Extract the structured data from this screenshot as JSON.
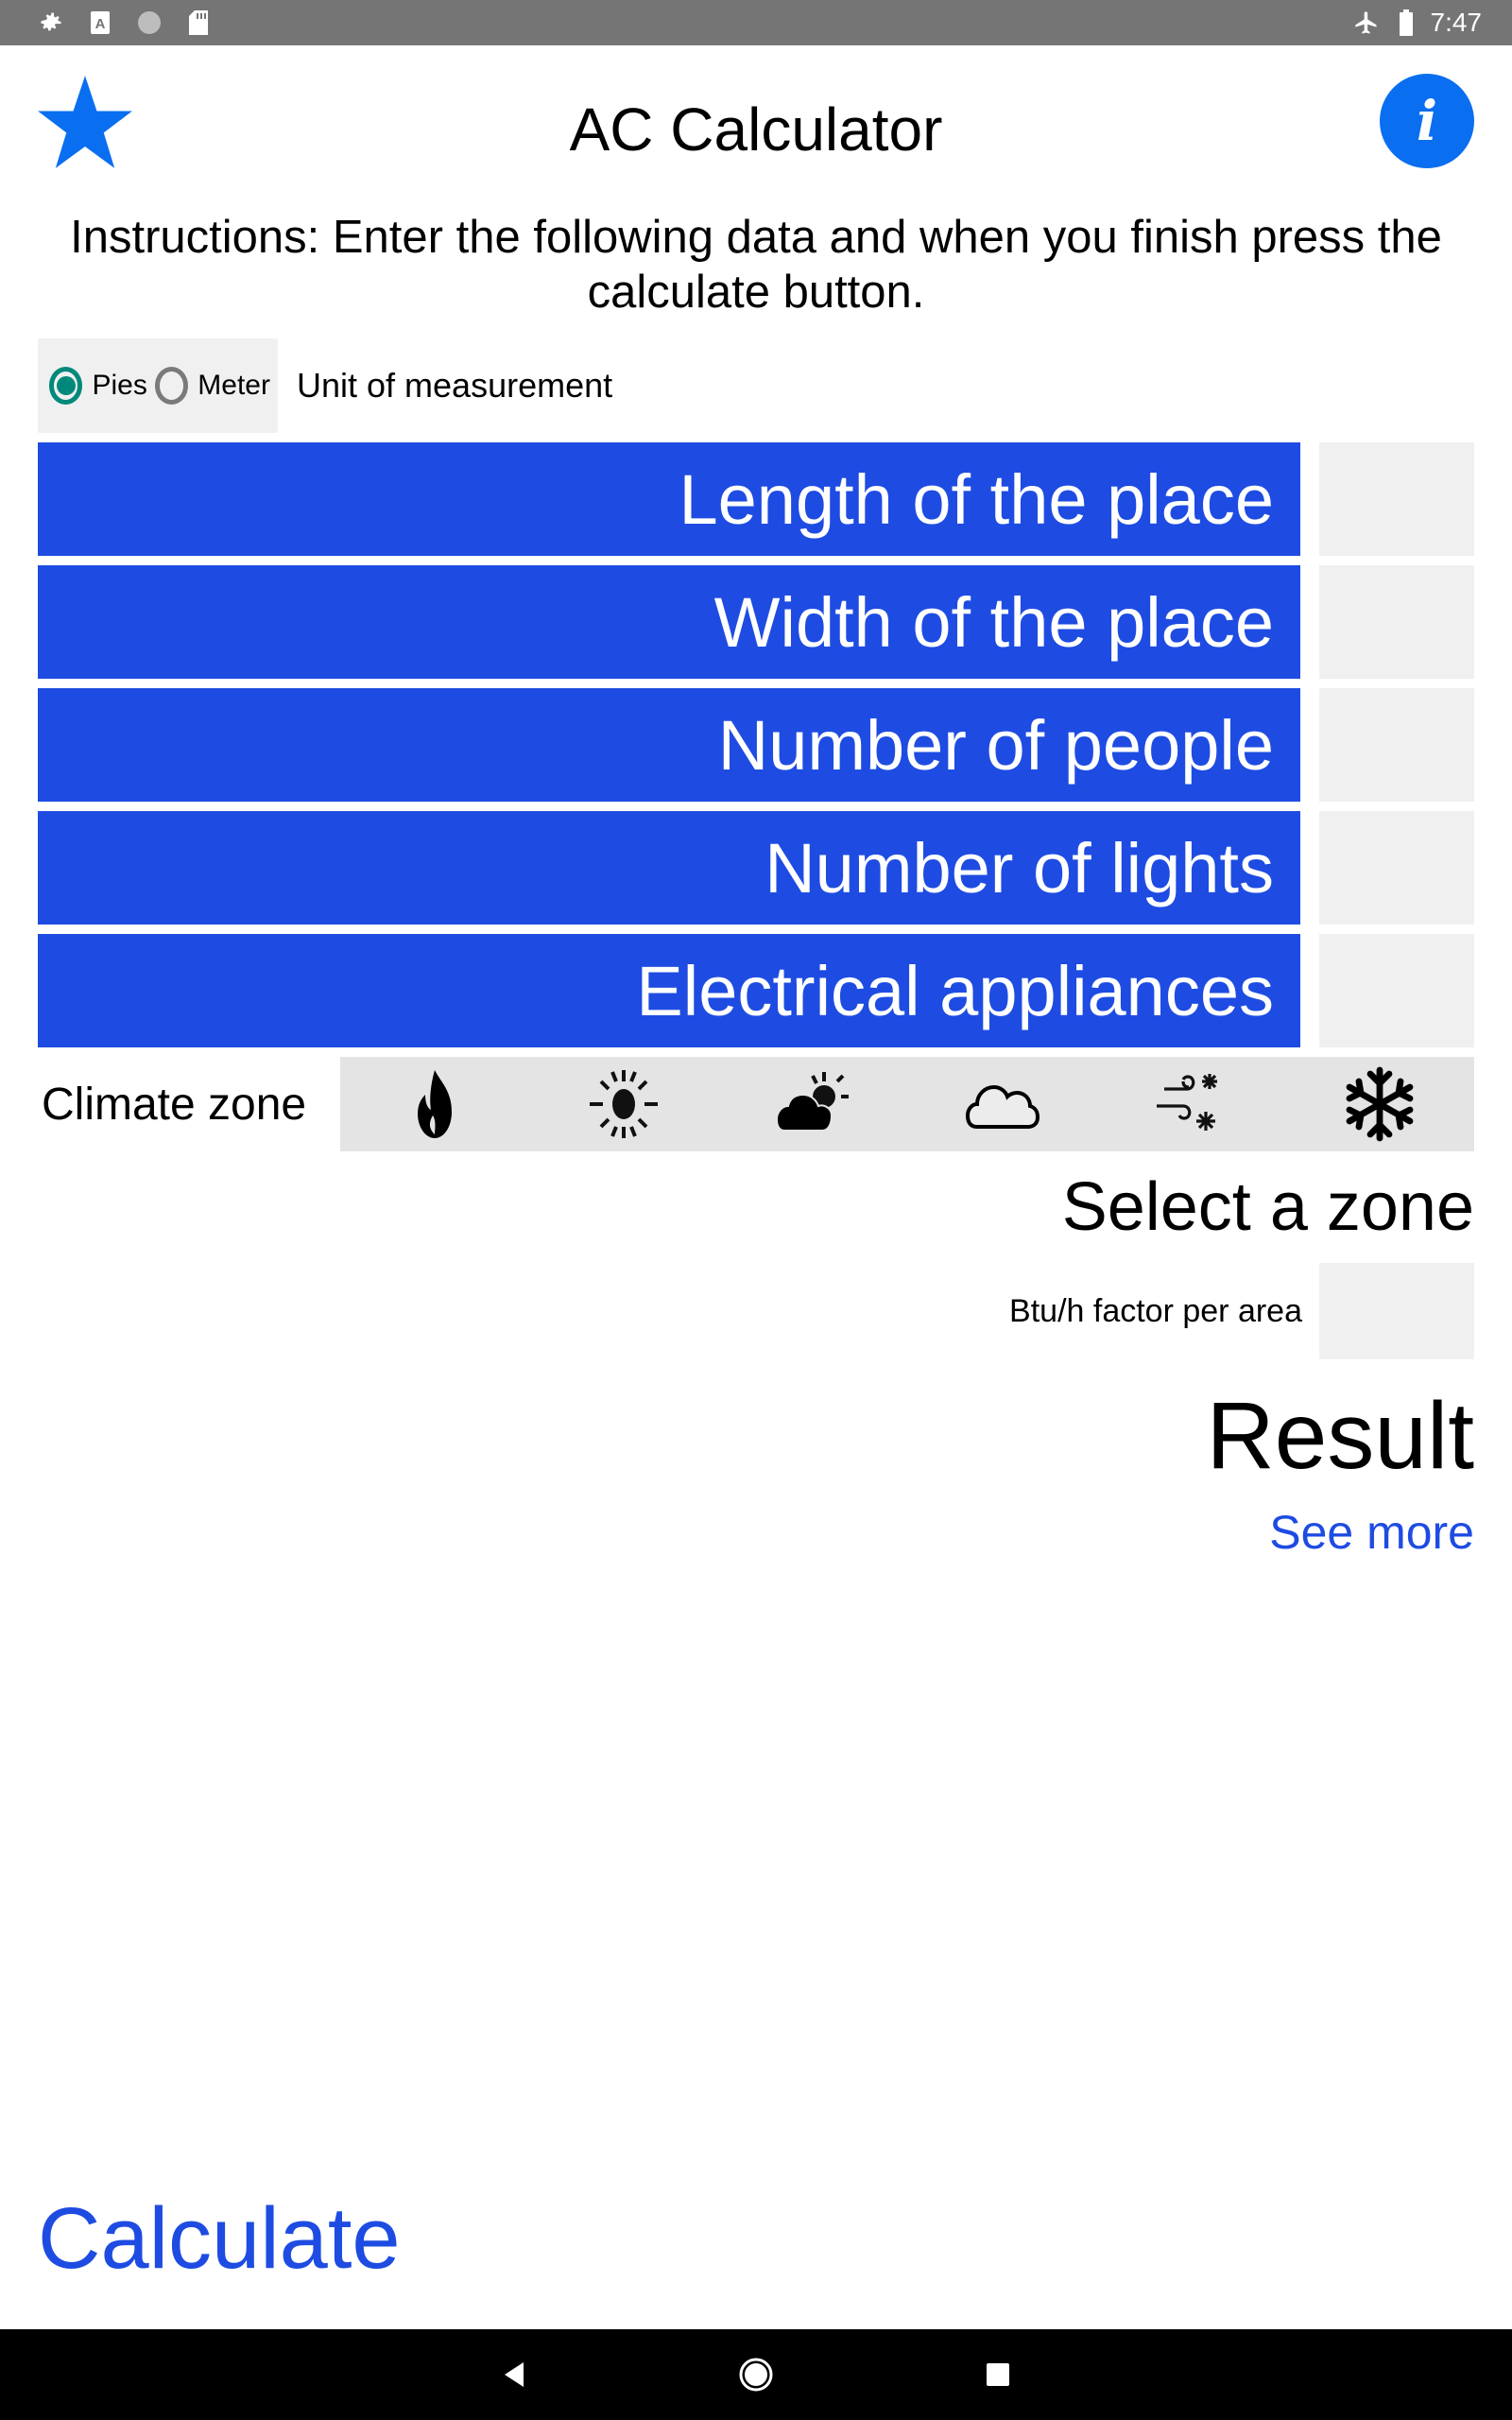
{
  "status_bar": {
    "time": "7:47",
    "left_icons": [
      "gear-icon",
      "font-a-icon",
      "circle-icon",
      "sd-card-icon"
    ],
    "right_icons": [
      "airplane-mode-icon",
      "battery-icon"
    ]
  },
  "header": {
    "title": "AC Calculator",
    "star_icon": "star-icon",
    "info_label": "i"
  },
  "instructions": "Instructions: Enter the following data and when you finish press the calculate button.",
  "units": {
    "label": "Unit of measurement",
    "options": [
      {
        "label": "Pies",
        "checked": true
      },
      {
        "label": "Meter",
        "checked": false
      }
    ]
  },
  "fields": [
    {
      "label": "Length of the place",
      "value": ""
    },
    {
      "label": "Width of the place",
      "value": ""
    },
    {
      "label": "Number of people",
      "value": ""
    },
    {
      "label": "Number of lights",
      "value": ""
    },
    {
      "label": "Electrical appliances",
      "value": ""
    }
  ],
  "climate": {
    "label": "Climate zone",
    "zones": [
      "fire-icon",
      "sun-icon",
      "partly-cloudy-icon",
      "cloud-icon",
      "wind-snow-icon",
      "snowflake-icon"
    ],
    "selection_text": "Select a zone"
  },
  "factor": {
    "label": "Btu/h factor per area",
    "value": ""
  },
  "result": {
    "title": "Result",
    "see_more": "See more"
  },
  "calculate_label": "Calculate",
  "colors": {
    "primary_blue": "#1e4ce2",
    "info_blue": "#0a6ef0",
    "radio_teal": "#00897b",
    "input_grey": "#f0f0f0",
    "zone_bar_grey": "#e4e4e4"
  }
}
